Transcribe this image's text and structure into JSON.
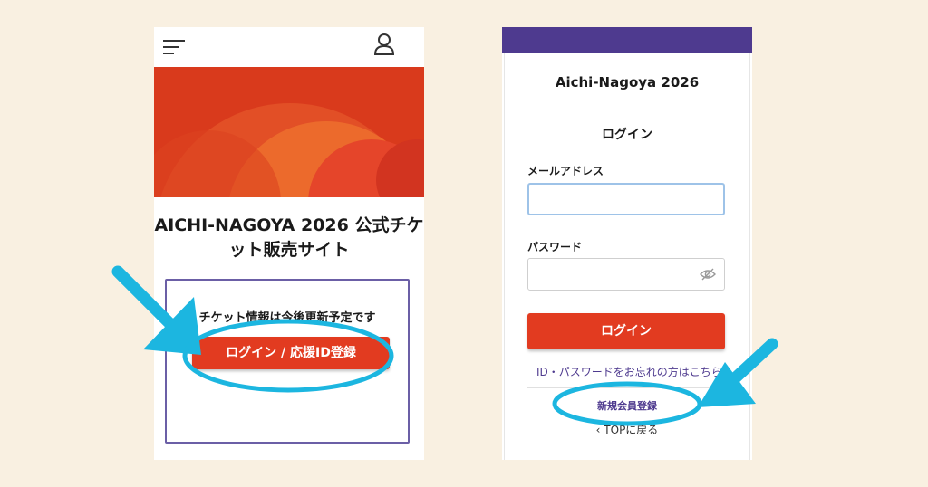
{
  "left_screen": {
    "title": "AICHI-NAGOYA 2026 公式チケット販売サイト",
    "info_text": "チケット情報は今後更新予定です",
    "login_button": "ログイン / 応援ID登録"
  },
  "right_screen": {
    "site_name": "Aichi-Nagoya 2026",
    "heading": "ログイン",
    "email": {
      "label": "メールアドレス",
      "value": ""
    },
    "password": {
      "label": "パスワード",
      "value": ""
    },
    "login_button": "ログイン",
    "forgot_link": "ID・パスワードをお忘れの方はこちら",
    "register_link": "新規会員登録",
    "top_link": "TOPに戻る"
  },
  "icons": [
    "menu-icon",
    "user-icon",
    "eye-slash-icon",
    "chevron-left-icon",
    "arrow-icon"
  ],
  "colors": {
    "background": "#f9f0e1",
    "accent_red": "#e23b20",
    "purple": "#4e3a8f",
    "annotation_cyan": "#1cb6e0"
  }
}
